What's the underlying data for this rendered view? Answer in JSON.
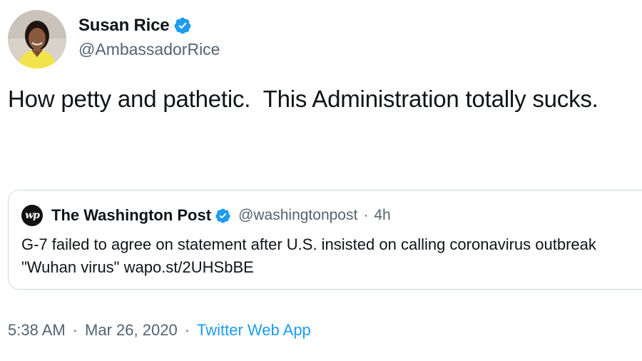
{
  "author": {
    "display_name": "Susan Rice",
    "handle": "@AmbassadorRice",
    "verified": true,
    "avatar": "profile-photo"
  },
  "tweet": {
    "text": "How petty and pathetic.  This Administration totally sucks."
  },
  "quoted_tweet": {
    "avatar_text": "wp",
    "display_name": "The Washington Post",
    "handle": "@washingtonpost",
    "separator": "·",
    "time": "4h",
    "verified": true,
    "text": "G-7 failed to agree on statement after U.S. insisted on calling coronavirus outbreak \"Wuhan virus\" wapo.st/2UHSbBE"
  },
  "footer": {
    "time": "5:38 AM",
    "separator": "·",
    "date": "Mar 26, 2020",
    "source": "Twitter Web App"
  },
  "colors": {
    "verified_badge": "#1d9bf0",
    "secondary_text": "#536471",
    "link": "#1d9bf0"
  }
}
